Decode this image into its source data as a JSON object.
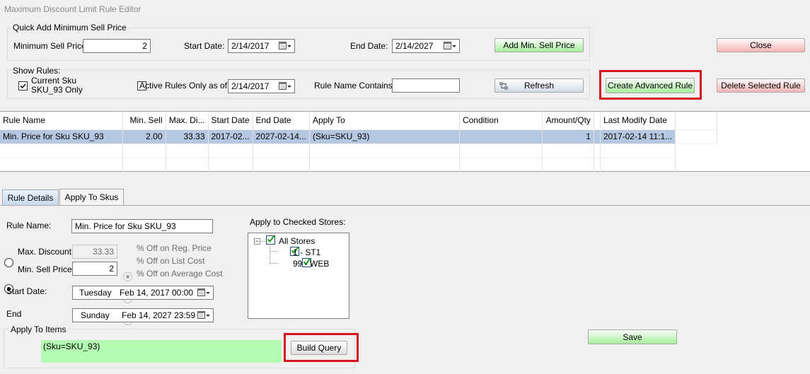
{
  "window": {
    "title": "Maximum Discount Limit Rule Editor"
  },
  "quick_add": {
    "title": "Quick Add Minimum Sell Price",
    "min_sell_label": "Minimum Sell Price:",
    "min_sell_value": "2",
    "start_label": "Start Date:",
    "start_value": "2/14/2017",
    "end_label": "End Date:",
    "end_value": "2/14/2027",
    "add_button": "Add Min. Sell Price"
  },
  "show_rules": {
    "title": "Show Rules:",
    "current_sku_label": "Current Sku SKU_93 Only",
    "active_only_label": "Active Rules Only as of",
    "active_date": "2/14/2017",
    "name_contains_label": "Rule Name Contains:",
    "name_contains_value": "",
    "refresh_button": "Refresh"
  },
  "buttons": {
    "close": "Close",
    "create_advanced": "Create Advanced Rule",
    "delete_selected": "Delete Selected Rule",
    "save": "Save",
    "build_query": "Build Query"
  },
  "grid": {
    "columns": [
      "Rule Name",
      "Min. Sell",
      "Max. Di...",
      "Start Date",
      "End Date",
      "Apply To",
      "Condition",
      "Amount/Qty",
      "Last Modify Date"
    ],
    "rows": [
      [
        "Min. Price for Sku SKU_93",
        "2.00",
        "33.33",
        "2017-02...",
        "2027-02-14...",
        "(Sku=SKU_93)",
        "",
        "1",
        "2017-02-14 11:1..."
      ]
    ]
  },
  "tabs": [
    {
      "label": "Rule Details",
      "active": true
    },
    {
      "label": "Apply To Skus",
      "active": false
    }
  ],
  "details": {
    "rule_name_label": "Rule Name:",
    "rule_name_value": "Min. Price for Sku SKU_93",
    "max_discount_label": "Max. Discount",
    "max_discount_value": "33.33",
    "min_sell_label": "Min. Sell Price",
    "min_sell_value": "2",
    "pct_options": [
      "% Off on Reg. Price",
      "% Off on List Cost",
      "% Off on Average Cost"
    ],
    "start_label": "Start Date:",
    "start_day": "Tuesday",
    "start_value": "Feb 14, 2017 00:00",
    "end_label": "End",
    "end_day": "Sunday",
    "end_value": "Feb 14, 2027 23:59",
    "apply_items_title": "Apply To Items",
    "apply_items_query": "(Sku=SKU_93)",
    "stores_label": "Apply to Checked Stores:",
    "stores_tree": {
      "root": "All Stores",
      "children": [
        "1 - ST1",
        "99 - WEB"
      ]
    }
  },
  "colors": {
    "highlight": "#d4141e",
    "selected_row": "#b5c7e1",
    "query_bg": "#b3fbb2",
    "check_green": "#1a9a1a"
  }
}
